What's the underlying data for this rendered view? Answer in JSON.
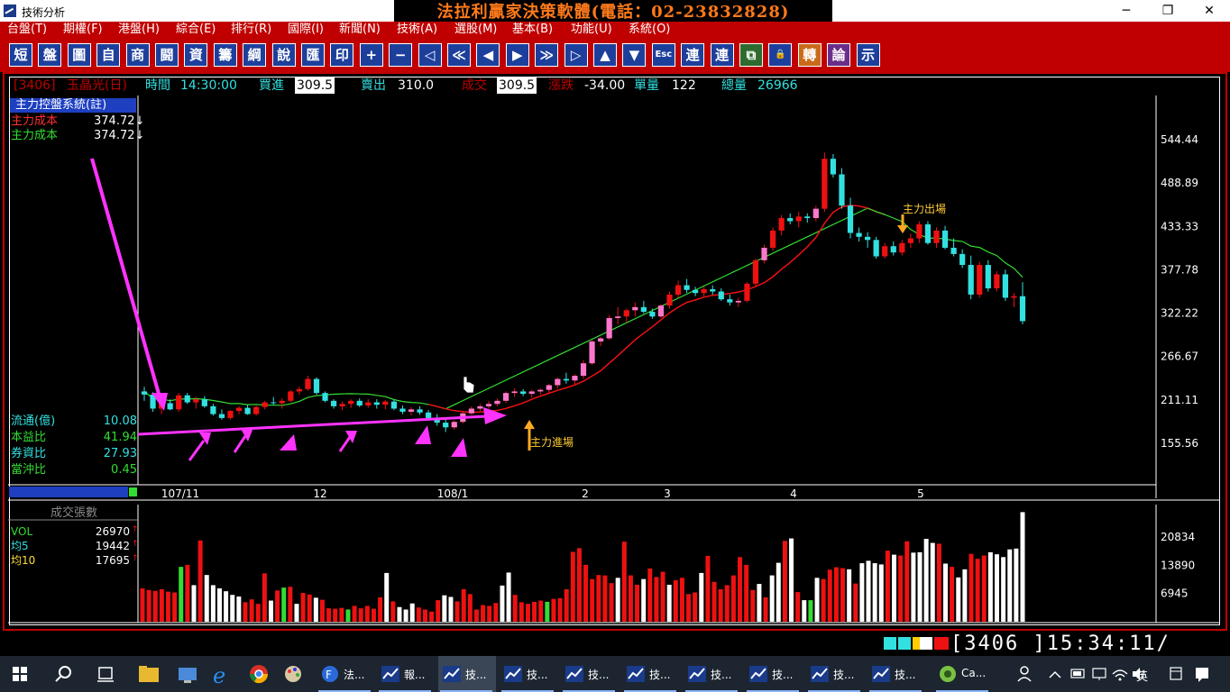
{
  "window": {
    "title": "技術分析",
    "banner": "法拉利贏家決策軟體(電話：02-23832828)",
    "minimize": "─",
    "maximize": "❐",
    "close": "✕"
  },
  "menu": [
    "台盤(T)",
    "期權(F)",
    "港盤(H)",
    "綜合(E)",
    "排行(R)",
    "國際(I)",
    "新聞(N)",
    "技術(A)",
    "選股(M)",
    "基本(B)",
    "功能(U)",
    "系統(O)"
  ],
  "toolbar": [
    "短",
    "盤",
    "圖",
    "自",
    "商",
    "闘",
    "資",
    "籌",
    "綱",
    "說",
    "匯",
    "印",
    "+",
    "−",
    "◁",
    "≪",
    "◀",
    "▶",
    "≫",
    "▷",
    "▲",
    "▼",
    "Esc",
    "連",
    "連",
    "⧉",
    "🔒",
    "轉",
    "論",
    "示"
  ],
  "info": {
    "code": "[3406]",
    "name": "玉晶光(日)",
    "time_label": "時間",
    "time": "14:30:00",
    "buy_label": "買進",
    "buy": "309.5",
    "sell_label": "賣出",
    "sell": "310.0",
    "deal_label": "成交",
    "deal": "309.5",
    "change_label": "漲跌",
    "change": "-34.00",
    "vol_label": "單量",
    "vol": "122",
    "total_label": "總量",
    "total": "26966"
  },
  "side": {
    "title": "主力控盤系統(註)",
    "cost1_label": "主力成本",
    "cost1": "374.72↓",
    "cost2_label": "主力成本",
    "cost2": "374.72↓",
    "stats": [
      {
        "label": "流通(億)",
        "value": "10.08"
      },
      {
        "label": "本益比",
        "value": "41.94"
      },
      {
        "label": "券資比",
        "value": "27.93"
      },
      {
        "label": "當沖比",
        "value": "0.45"
      }
    ]
  },
  "volume_panel": {
    "title": "成交張數",
    "rows": [
      {
        "label": "VOL",
        "value": "26970"
      },
      {
        "label": "均5",
        "value": "19442"
      },
      {
        "label": "均10",
        "value": "17695"
      }
    ]
  },
  "annotations": {
    "enter": "主力進場",
    "exit": "主力出場"
  },
  "chart_data": {
    "type": "candlestick",
    "price_ticks": [
      "544.44",
      "488.89",
      "433.33",
      "377.78",
      "322.22",
      "266.67",
      "211.11",
      "155.56"
    ],
    "price_ylim": [
      155.56,
      544.44
    ],
    "volume_ticks": [
      "20834",
      "13890",
      "6945"
    ],
    "x_labels": [
      "107/11",
      "12",
      "108/1",
      "2",
      "3",
      "4",
      "5"
    ],
    "candles": [
      [
        222,
        228,
        210,
        218
      ],
      [
        218,
        221,
        196,
        200
      ],
      [
        200,
        210,
        193,
        207
      ],
      [
        207,
        212,
        198,
        199
      ],
      [
        199,
        220,
        196,
        217
      ],
      [
        217,
        220,
        206,
        208
      ],
      [
        208,
        215,
        200,
        212
      ],
      [
        212,
        216,
        201,
        203
      ],
      [
        203,
        206,
        191,
        193
      ],
      [
        193,
        199,
        186,
        188
      ],
      [
        188,
        198,
        186,
        197
      ],
      [
        197,
        203,
        193,
        201
      ],
      [
        201,
        205,
        192,
        193
      ],
      [
        193,
        204,
        191,
        202
      ],
      [
        202,
        210,
        199,
        208
      ],
      [
        208,
        215,
        205,
        207
      ],
      [
        207,
        213,
        200,
        210
      ],
      [
        210,
        224,
        208,
        222
      ],
      [
        222,
        228,
        218,
        225
      ],
      [
        225,
        242,
        223,
        238
      ],
      [
        238,
        240,
        218,
        220
      ],
      [
        220,
        222,
        208,
        210
      ],
      [
        210,
        212,
        200,
        203
      ],
      [
        203,
        209,
        198,
        206
      ],
      [
        206,
        212,
        201,
        210
      ],
      [
        210,
        213,
        202,
        204
      ],
      [
        204,
        212,
        201,
        208
      ],
      [
        208,
        212,
        200,
        205
      ],
      [
        205,
        211,
        199,
        209
      ],
      [
        209,
        212,
        198,
        200
      ],
      [
        200,
        204,
        193,
        196
      ],
      [
        196,
        202,
        191,
        199
      ],
      [
        199,
        203,
        192,
        195
      ],
      [
        195,
        198,
        185,
        188
      ],
      [
        188,
        193,
        178,
        182
      ],
      [
        182,
        186,
        170,
        176
      ],
      [
        176,
        185,
        173,
        183
      ],
      [
        183,
        196,
        181,
        194
      ],
      [
        194,
        203,
        192,
        200
      ],
      [
        200,
        206,
        197,
        203
      ],
      [
        203,
        210,
        200,
        206
      ],
      [
        206,
        213,
        203,
        210
      ],
      [
        210,
        222,
        207,
        220
      ],
      [
        220,
        226,
        215,
        222
      ],
      [
        222,
        225,
        216,
        219
      ],
      [
        219,
        224,
        214,
        222
      ],
      [
        222,
        226,
        218,
        224
      ],
      [
        224,
        232,
        220,
        230
      ],
      [
        230,
        240,
        226,
        238
      ],
      [
        238,
        246,
        232,
        236
      ],
      [
        236,
        244,
        230,
        242
      ],
      [
        242,
        262,
        238,
        258
      ],
      [
        258,
        288,
        256,
        286
      ],
      [
        286,
        292,
        280,
        290
      ],
      [
        290,
        320,
        288,
        316
      ],
      [
        316,
        330,
        308,
        318
      ],
      [
        318,
        328,
        310,
        326
      ],
      [
        326,
        336,
        318,
        330
      ],
      [
        330,
        338,
        322,
        324
      ],
      [
        324,
        328,
        315,
        318
      ],
      [
        318,
        334,
        316,
        332
      ],
      [
        332,
        350,
        328,
        346
      ],
      [
        346,
        364,
        342,
        358
      ],
      [
        358,
        366,
        348,
        352
      ],
      [
        352,
        356,
        344,
        348
      ],
      [
        348,
        356,
        342,
        353
      ],
      [
        353,
        358,
        346,
        350
      ],
      [
        350,
        354,
        338,
        340
      ],
      [
        340,
        346,
        332,
        336
      ],
      [
        336,
        342,
        330,
        338
      ],
      [
        338,
        362,
        336,
        360
      ],
      [
        360,
        392,
        356,
        390
      ],
      [
        390,
        410,
        386,
        406
      ],
      [
        406,
        432,
        402,
        428
      ],
      [
        428,
        448,
        422,
        444
      ],
      [
        444,
        450,
        436,
        440
      ],
      [
        440,
        452,
        432,
        446
      ],
      [
        446,
        450,
        438,
        444
      ],
      [
        444,
        460,
        440,
        456
      ],
      [
        456,
        528,
        452,
        520
      ],
      [
        520,
        526,
        496,
        500
      ],
      [
        500,
        508,
        456,
        460
      ],
      [
        460,
        470,
        418,
        425
      ],
      [
        425,
        432,
        414,
        420
      ],
      [
        420,
        426,
        406,
        416
      ],
      [
        416,
        420,
        392,
        395
      ],
      [
        395,
        412,
        392,
        408
      ],
      [
        408,
        414,
        396,
        400
      ],
      [
        400,
        416,
        396,
        412
      ],
      [
        412,
        424,
        406,
        418
      ],
      [
        418,
        440,
        412,
        436
      ],
      [
        436,
        440,
        410,
        412
      ],
      [
        412,
        432,
        406,
        428
      ],
      [
        428,
        434,
        404,
        406
      ],
      [
        406,
        418,
        395,
        398
      ],
      [
        398,
        404,
        380,
        384
      ],
      [
        384,
        396,
        340,
        346
      ],
      [
        346,
        388,
        342,
        384
      ],
      [
        384,
        390,
        350,
        354
      ],
      [
        354,
        376,
        350,
        372
      ],
      [
        372,
        378,
        338,
        342
      ],
      [
        342,
        348,
        330,
        344
      ],
      [
        344,
        362,
        308,
        312
      ]
    ],
    "volumes": [
      [
        8200,
        "r"
      ],
      [
        7800,
        "r"
      ],
      [
        7600,
        "r"
      ],
      [
        8000,
        "r"
      ],
      [
        7400,
        "r"
      ],
      [
        7200,
        "r"
      ],
      [
        13500,
        "g"
      ],
      [
        14000,
        "r"
      ],
      [
        9000,
        "w"
      ],
      [
        20000,
        "r"
      ],
      [
        11500,
        "w"
      ],
      [
        9000,
        "w"
      ],
      [
        8200,
        "w"
      ],
      [
        7500,
        "w"
      ],
      [
        6600,
        "w"
      ],
      [
        6200,
        "w"
      ],
      [
        4800,
        "r"
      ],
      [
        5500,
        "r"
      ],
      [
        4400,
        "r"
      ],
      [
        11900,
        "r"
      ],
      [
        5200,
        "w"
      ],
      [
        7700,
        "r"
      ],
      [
        8400,
        "g"
      ],
      [
        8600,
        "r"
      ],
      [
        4400,
        "w"
      ],
      [
        7100,
        "r"
      ],
      [
        6700,
        "r"
      ],
      [
        5900,
        "w"
      ],
      [
        5400,
        "r"
      ],
      [
        3300,
        "r"
      ],
      [
        3200,
        "r"
      ],
      [
        3400,
        "r"
      ],
      [
        3000,
        "g"
      ],
      [
        3900,
        "r"
      ],
      [
        3300,
        "r"
      ],
      [
        3900,
        "r"
      ],
      [
        3200,
        "r"
      ],
      [
        6000,
        "r"
      ],
      [
        12000,
        "w"
      ],
      [
        5000,
        "r"
      ],
      [
        3600,
        "w"
      ],
      [
        3000,
        "w"
      ],
      [
        4500,
        "w"
      ],
      [
        3500,
        "r"
      ],
      [
        3000,
        "r"
      ],
      [
        2500,
        "r"
      ],
      [
        5300,
        "r"
      ],
      [
        6500,
        "w"
      ],
      [
        6100,
        "w"
      ],
      [
        5000,
        "r"
      ],
      [
        8000,
        "r"
      ],
      [
        6800,
        "r"
      ],
      [
        3000,
        "r"
      ],
      [
        4100,
        "r"
      ],
      [
        3900,
        "r"
      ],
      [
        4600,
        "r"
      ],
      [
        8900,
        "w"
      ],
      [
        12100,
        "w"
      ],
      [
        6600,
        "r"
      ],
      [
        4800,
        "r"
      ],
      [
        4400,
        "r"
      ],
      [
        4900,
        "r"
      ],
      [
        5200,
        "r"
      ],
      [
        4900,
        "g"
      ],
      [
        5600,
        "r"
      ],
      [
        5800,
        "r"
      ],
      [
        8000,
        "r"
      ],
      [
        17200,
        "r"
      ],
      [
        18100,
        "r"
      ],
      [
        14000,
        "r"
      ],
      [
        10500,
        "r"
      ],
      [
        11500,
        "r"
      ],
      [
        11400,
        "r"
      ],
      [
        9500,
        "r"
      ],
      [
        10800,
        "w"
      ],
      [
        19700,
        "r"
      ],
      [
        11400,
        "r"
      ],
      [
        9100,
        "r"
      ],
      [
        10500,
        "w"
      ],
      [
        13100,
        "r"
      ],
      [
        11000,
        "r"
      ],
      [
        12300,
        "r"
      ],
      [
        9100,
        "w"
      ],
      [
        10200,
        "r"
      ],
      [
        10800,
        "r"
      ],
      [
        6800,
        "r"
      ],
      [
        7200,
        "r"
      ],
      [
        12000,
        "w"
      ],
      [
        16200,
        "r"
      ],
      [
        9800,
        "r"
      ],
      [
        8000,
        "r"
      ],
      [
        9000,
        "r"
      ],
      [
        11400,
        "r"
      ],
      [
        15900,
        "r"
      ],
      [
        14000,
        "r"
      ],
      [
        7800,
        "r"
      ],
      [
        9300,
        "w"
      ],
      [
        6000,
        "r"
      ],
      [
        11400,
        "w"
      ],
      [
        14500,
        "w"
      ],
      [
        19900,
        "r"
      ],
      [
        20500,
        "w"
      ],
      [
        7300,
        "r"
      ],
      [
        5300,
        "w"
      ],
      [
        5300,
        "g"
      ],
      [
        10800,
        "w"
      ],
      [
        10500,
        "r"
      ],
      [
        12800,
        "r"
      ],
      [
        13400,
        "r"
      ],
      [
        13200,
        "r"
      ],
      [
        12900,
        "w"
      ],
      [
        9400,
        "r"
      ],
      [
        14400,
        "w"
      ],
      [
        15000,
        "w"
      ],
      [
        14400,
        "w"
      ],
      [
        14100,
        "w"
      ],
      [
        17500,
        "r"
      ],
      [
        16500,
        "w"
      ],
      [
        16300,
        "r"
      ],
      [
        19800,
        "r"
      ],
      [
        17000,
        "w"
      ],
      [
        17100,
        "w"
      ],
      [
        20400,
        "w"
      ],
      [
        19400,
        "w"
      ],
      [
        19200,
        "r"
      ],
      [
        14300,
        "w"
      ],
      [
        13500,
        "r"
      ],
      [
        10900,
        "w"
      ],
      [
        12900,
        "w"
      ],
      [
        16700,
        "r"
      ],
      [
        15500,
        "r"
      ],
      [
        16300,
        "r"
      ],
      [
        17100,
        "w"
      ],
      [
        16600,
        "w"
      ],
      [
        15900,
        "w"
      ],
      [
        17800,
        "w"
      ],
      [
        18000,
        "w"
      ],
      [
        26970,
        "w"
      ]
    ]
  },
  "status": {
    "code": "[3406  ]15:34:11/"
  },
  "taskbar": {
    "items": [
      "法...",
      "報...",
      "技...",
      "技...",
      "技...",
      "技...",
      "技...",
      "技...",
      "技...",
      "技...",
      "Ca..."
    ],
    "ime": "英"
  }
}
